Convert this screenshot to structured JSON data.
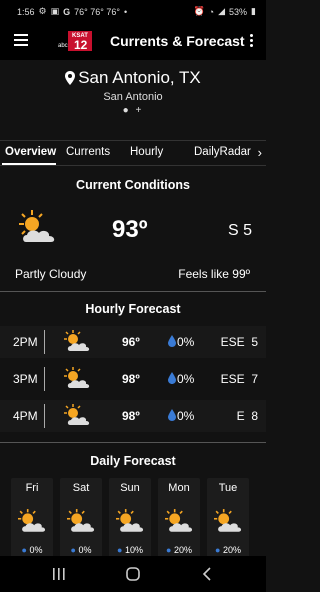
{
  "status_bar": {
    "time": "1:56",
    "temps": "76° 76° 76°",
    "dot": "•",
    "battery": "53%"
  },
  "app": {
    "title": "Currents & Forecast",
    "logo_text": "KSAT",
    "logo_num": "12",
    "logo_abc": "abc"
  },
  "location": {
    "city": "San Antonio, TX",
    "subtitle": "San Antonio",
    "page_indicator": "● +"
  },
  "tabs": [
    {
      "label": "Overview",
      "active": true
    },
    {
      "label": "Currents"
    },
    {
      "label": "Hourly"
    },
    {
      "label": "DailyRadar"
    }
  ],
  "current": {
    "title": "Current Conditions",
    "temperature": "93º",
    "wind": "S  5",
    "condition": "Partly Cloudy",
    "feels_like": "Feels like 99º",
    "icon": "partly-cloudy-icon"
  },
  "hourly": {
    "title": "Hourly Forecast",
    "rows": [
      {
        "time": "2PM",
        "temp": "96º",
        "pop": "0%",
        "wind_dir": "ESE",
        "wind_speed": "5"
      },
      {
        "time": "3PM",
        "temp": "98º",
        "pop": "0%",
        "wind_dir": "ESE",
        "wind_speed": "7"
      },
      {
        "time": "4PM",
        "temp": "98º",
        "pop": "0%",
        "wind_dir": "E",
        "wind_speed": "8"
      }
    ]
  },
  "daily": {
    "title": "Daily Forecast",
    "days": [
      {
        "name": "Fri",
        "pop": "0%"
      },
      {
        "name": "Sat",
        "pop": "0%"
      },
      {
        "name": "Sun",
        "pop": "10%"
      },
      {
        "name": "Mon",
        "pop": "20%"
      },
      {
        "name": "Tue",
        "pop": "20%"
      }
    ]
  },
  "colors": {
    "background": "#121212",
    "sun": "#f5a623",
    "rain_drop": "#3a7bd5"
  }
}
